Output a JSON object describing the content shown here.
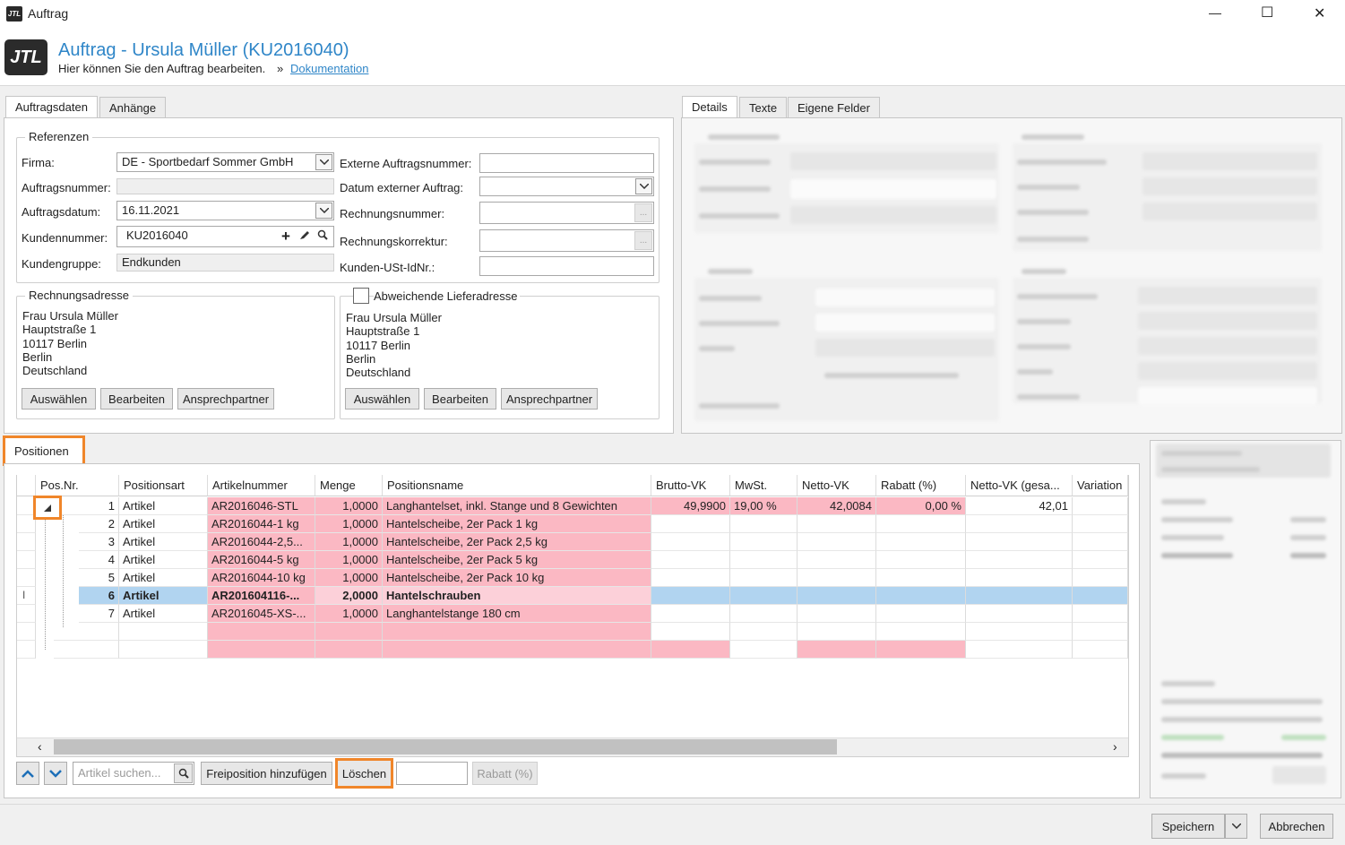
{
  "window": {
    "title": "Auftrag",
    "minimize": "—",
    "maximize": "☐",
    "close": "✕"
  },
  "header": {
    "logo": "JTL",
    "title": "Auftrag - Ursula Müller (KU2016040)",
    "subtitle": "Hier können Sie den Auftrag bearbeiten.",
    "sep": "»",
    "doc_link": "Dokumentation"
  },
  "left_tabs": [
    "Auftragsdaten",
    "Anhänge"
  ],
  "right_tabs": [
    "Details",
    "Texte",
    "Eigene Felder"
  ],
  "referenzen": {
    "title": "Referenzen",
    "firma_label": "Firma:",
    "firma_value": "DE - Sportbedarf Sommer GmbH",
    "auftragsnummer_label": "Auftragsnummer:",
    "auftragsnummer_value": "",
    "auftragsdatum_label": "Auftragsdatum:",
    "auftragsdatum_value": "16.11.2021",
    "kundennummer_label": "Kundennummer:",
    "kundennummer_value": "KU2016040",
    "kundengruppe_label": "Kundengruppe:",
    "kundengruppe_value": "Endkunden",
    "ext_nr_label": "Externe Auftragsnummer:",
    "ext_datum_label": "Datum externer Auftrag:",
    "rechnungsnummer_label": "Rechnungsnummer:",
    "rechnungskorrektur_label": "Rechnungskorrektur:",
    "ustid_label": "Kunden-USt-IdNr.:",
    "ellipsis": "..."
  },
  "rechnungsadresse": {
    "title": "Rechnungsadresse",
    "lines": [
      "Frau Ursula Müller",
      "Hauptstraße 1",
      "10117 Berlin",
      "Berlin",
      "Deutschland"
    ],
    "buttons": [
      "Auswählen",
      "Bearbeiten",
      "Ansprechpartner"
    ]
  },
  "lieferadresse": {
    "title": "Abweichende Lieferadresse",
    "checked": false,
    "lines": [
      "Frau Ursula Müller",
      "Hauptstraße 1",
      "10117 Berlin",
      "Berlin",
      "Deutschland"
    ],
    "buttons": [
      "Auswählen",
      "Bearbeiten",
      "Ansprechpartner"
    ]
  },
  "positionen": {
    "tab": "Positionen",
    "columns": [
      "Pos.Nr.",
      "Positionsart",
      "Artikelnummer",
      "Menge",
      "Positionsname",
      "Brutto-VK",
      "MwSt.",
      "Netto-VK",
      "Rabatt (%)",
      "Netto-VK (gesa...",
      "Variation"
    ],
    "rows": [
      {
        "nr": "1",
        "art": "Artikel",
        "artnr": "AR2016046-STL",
        "menge": "1,0000",
        "name": "Langhantelset, inkl. Stange und 8 Gewichten",
        "brutto": "49,9900",
        "mwst": "19,00 %",
        "netto": "42,0084",
        "rabatt": "0,00 %",
        "nettoges": "42,01"
      },
      {
        "nr": "2",
        "art": "Artikel",
        "artnr": "AR2016044-1 kg",
        "menge": "1,0000",
        "name": "Hantelscheibe, 2er Pack 1 kg"
      },
      {
        "nr": "3",
        "art": "Artikel",
        "artnr": "AR2016044-2,5...",
        "menge": "1,0000",
        "name": "Hantelscheibe, 2er Pack 2,5 kg"
      },
      {
        "nr": "4",
        "art": "Artikel",
        "artnr": "AR2016044-5 kg",
        "menge": "1,0000",
        "name": "Hantelscheibe, 2er Pack 5 kg"
      },
      {
        "nr": "5",
        "art": "Artikel",
        "artnr": "AR2016044-10 kg",
        "menge": "1,0000",
        "name": "Hantelscheibe, 2er Pack 10 kg"
      },
      {
        "nr": "6",
        "art": "Artikel",
        "artnr": "AR201604116-...",
        "menge": "2,0000",
        "name": "Hantelschrauben"
      },
      {
        "nr": "7",
        "art": "Artikel",
        "artnr": "AR2016045-XS-...",
        "menge": "1,0000",
        "name": "Langhantelstange 180 cm"
      }
    ],
    "row_cursor": "I"
  },
  "toolbar": {
    "search_placeholder": "Artikel suchen...",
    "freiposition": "Freiposition hinzufügen",
    "loeschen": "Löschen",
    "rabatt": "Rabatt (%)"
  },
  "footer": {
    "speichern": "Speichern",
    "abbrechen": "Abbrechen"
  }
}
